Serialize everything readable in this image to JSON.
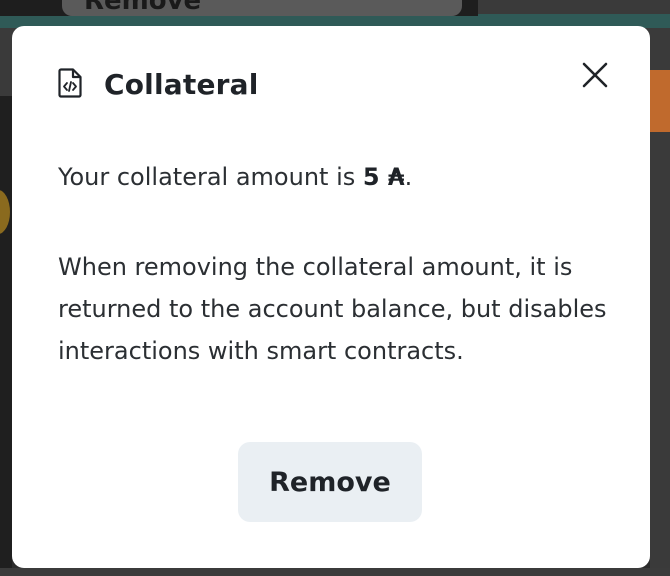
{
  "background": {
    "partial_button_label": "Remove"
  },
  "modal": {
    "title": "Collateral",
    "title_icon": "document-code-icon",
    "close_icon": "close-icon",
    "amount_prefix": "Your collateral amount is ",
    "amount_value": "5 ₳",
    "amount_suffix": ".",
    "description": "When removing the collateral amount, it is returned to the account balance, but disables interactions with smart contracts.",
    "remove_label": "Remove"
  },
  "colors": {
    "modal_bg": "#ffffff",
    "button_bg": "#eaeff3",
    "text": "#1f2328",
    "overlay_teal": "#2f5a57",
    "overlay_orange": "#c06a2d"
  }
}
